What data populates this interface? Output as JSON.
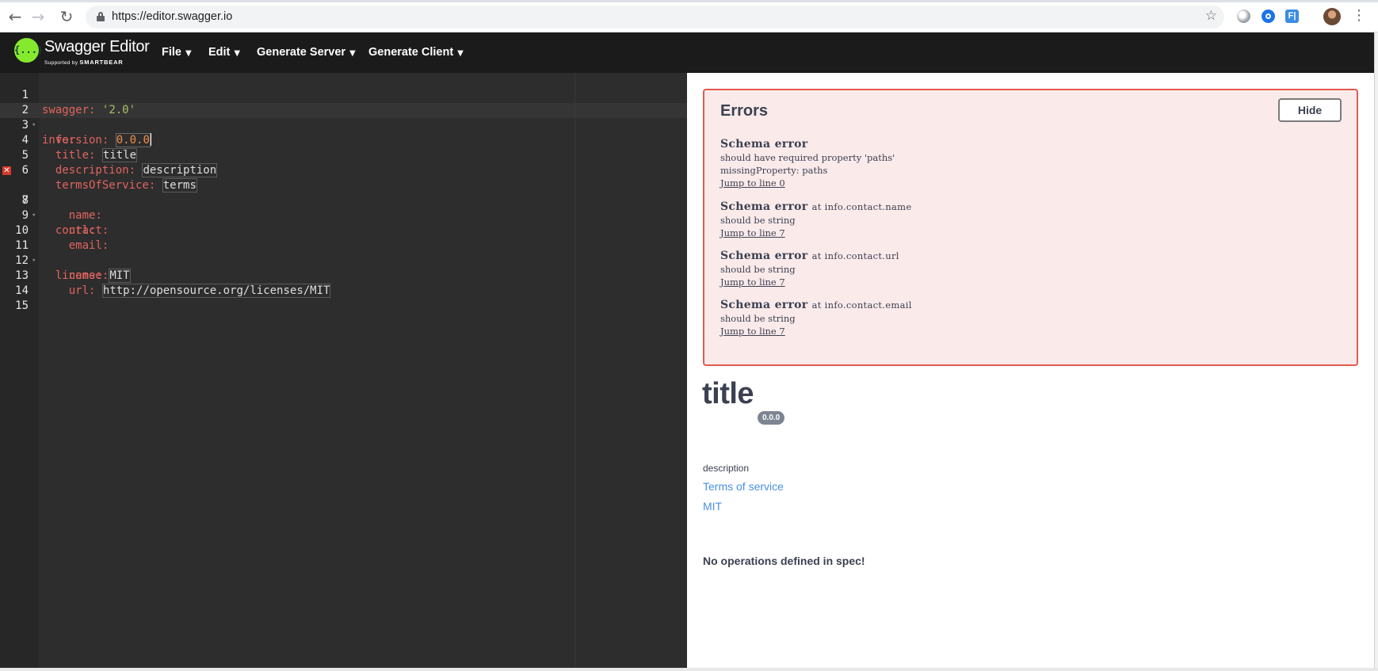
{
  "browser": {
    "url": "https://editor.swagger.io",
    "star_glyph": "☆",
    "extension_label": "F|"
  },
  "app": {
    "logo_glyph": "{...}",
    "title": "Swagger Editor",
    "subtitle_prefix": "Supported by",
    "subtitle_brand": "SMARTBEAR",
    "menus": [
      {
        "label": "File"
      },
      {
        "label": "Edit"
      },
      {
        "label": "Generate Server"
      },
      {
        "label": "Generate Client"
      }
    ],
    "caret": "▼"
  },
  "editor": {
    "lines": [
      {
        "n": "1"
      },
      {
        "n": "2"
      },
      {
        "n": "3"
      },
      {
        "n": "4"
      },
      {
        "n": "5"
      },
      {
        "n": "6"
      },
      {
        "n": "7"
      },
      {
        "n": "8"
      },
      {
        "n": "9"
      },
      {
        "n": "10"
      },
      {
        "n": "11"
      },
      {
        "n": "12"
      },
      {
        "n": "13"
      },
      {
        "n": "14"
      },
      {
        "n": "15"
      }
    ],
    "code": {
      "l1_key": "swagger",
      "l1_val": "'2.0'",
      "l2_key": "info",
      "l3_key": "version",
      "l3_val": "0.0.0",
      "l4_key": "title",
      "l4_val": "title",
      "l5_key": "description",
      "l5_val": "description",
      "l6_key": "termsOfService",
      "l6_val": "terms",
      "l7_key": "contact",
      "l8_key": "name",
      "l9_key": "url",
      "l10_key": "email",
      "l11_key": "license",
      "l12_key": "name",
      "l12_val": "MIT",
      "l13_key": "url",
      "l13_val": "http://opensource.org/licenses/MIT"
    },
    "colon": ":",
    "error_line": "7"
  },
  "errors": {
    "title": "Errors",
    "hide_label": "Hide",
    "items": [
      {
        "head": "Schema error",
        "at": "",
        "lines": [
          "should have required property 'paths'",
          "missingProperty: paths"
        ],
        "link": "Jump to line 0"
      },
      {
        "head": "Schema error",
        "at": "at info.contact.name",
        "lines": [
          "should be string"
        ],
        "link": "Jump to line 7"
      },
      {
        "head": "Schema error",
        "at": "at info.contact.url",
        "lines": [
          "should be string"
        ],
        "link": "Jump to line 7"
      },
      {
        "head": "Schema error",
        "at": "at info.contact.email",
        "lines": [
          "should be string"
        ],
        "link": "Jump to line 7"
      }
    ]
  },
  "info": {
    "title": "title",
    "version": "0.0.0",
    "description": "description",
    "terms_link": "Terms of service",
    "license_link": "MIT",
    "no_operations": "No operations defined in spec!"
  }
}
